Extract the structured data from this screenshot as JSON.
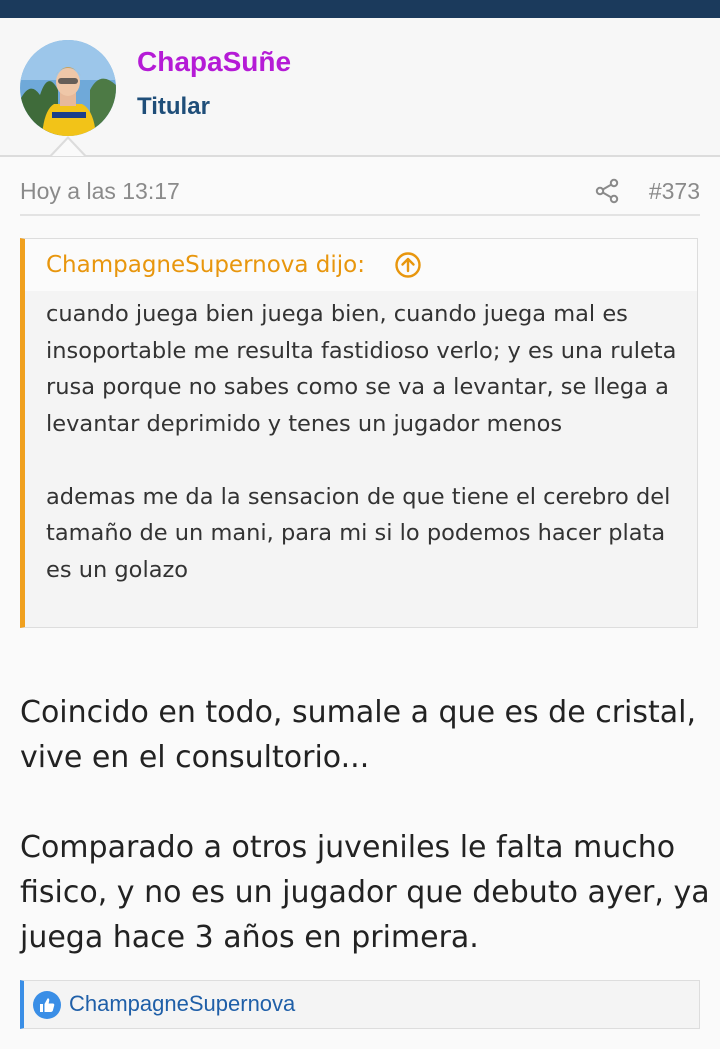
{
  "colors": {
    "topbar": "#1b3a5c",
    "username": "#b51bd6",
    "user_title": "#1f4e79",
    "quote_accent": "#f0a01e",
    "quote_author": "#e8960d",
    "reaction_accent": "#3a8ee6",
    "reaction_link": "#1f5fa8"
  },
  "user": {
    "name": "ChapaSuñe",
    "title": "Titular",
    "avatar_icon": "avatar-photo"
  },
  "post": {
    "date": "Hoy a las 13:17",
    "share_icon": "share-icon",
    "number": "#373"
  },
  "quote": {
    "author": "ChampagneSupernova dijo:",
    "jump_icon": "arrow-up-circle-icon",
    "paragraphs": [
      "cuando juega bien juega bien, cuando juega mal es insoportable me resulta fastidioso verlo; y es una ruleta rusa porque no sabes como se va a levantar, se llega a levantar deprimido y tenes un jugador menos",
      "ademas me da la sensacion de que tiene el cerebro del tamaño de un mani, para mi si lo podemos hacer plata es un golazo"
    ]
  },
  "message": {
    "paragraphs": [
      "Coincido en todo, sumale a que es de cristal, vive en el consultorio...",
      "Comparado a otros juveniles le falta mucho fisico, y no es un jugador que debuto ayer, ya juega hace 3 años en primera."
    ]
  },
  "reactions": {
    "icon": "like-icon",
    "users": "ChampagneSupernova"
  }
}
